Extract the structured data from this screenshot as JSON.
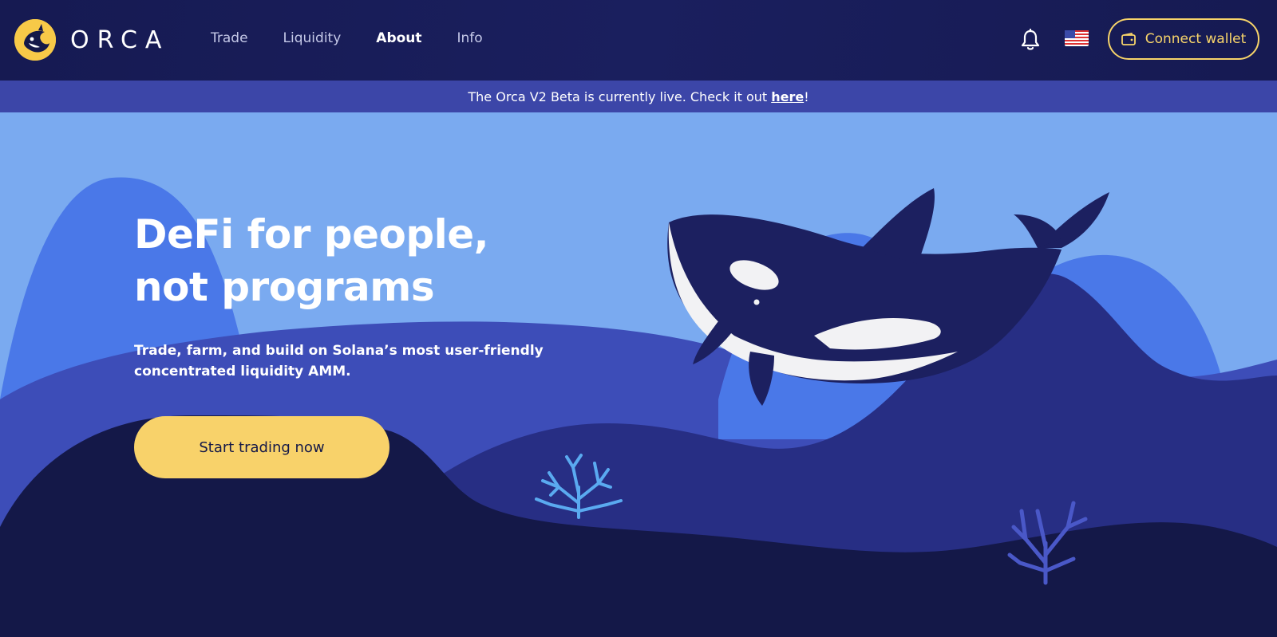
{
  "brand": {
    "name": "ORCA"
  },
  "nav": {
    "items": [
      {
        "label": "Trade",
        "active": false
      },
      {
        "label": "Liquidity",
        "active": false
      },
      {
        "label": "About",
        "active": true
      },
      {
        "label": "Info",
        "active": false
      }
    ],
    "connect_wallet": "Connect wallet",
    "icons": {
      "notifications": "bell-icon",
      "language": "us-flag-icon",
      "wallet": "wallet-icon"
    }
  },
  "banner": {
    "text": "The Orca V2 Beta is currently live. Check it out",
    "link": "here",
    "suffix": "!"
  },
  "hero": {
    "headline_line1": "DeFi for people,",
    "headline_line2": "not programs",
    "subtext": "Trade, farm, and build on Solana’s most user-friendly concentrated liquidity AMM.",
    "cta": "Start trading now"
  },
  "colors": {
    "nav_bg": "#161a52",
    "banner_bg": "#3c46a8",
    "accent": "#f7d46a",
    "sky": "#7aaaf0",
    "deep": "#141848"
  }
}
